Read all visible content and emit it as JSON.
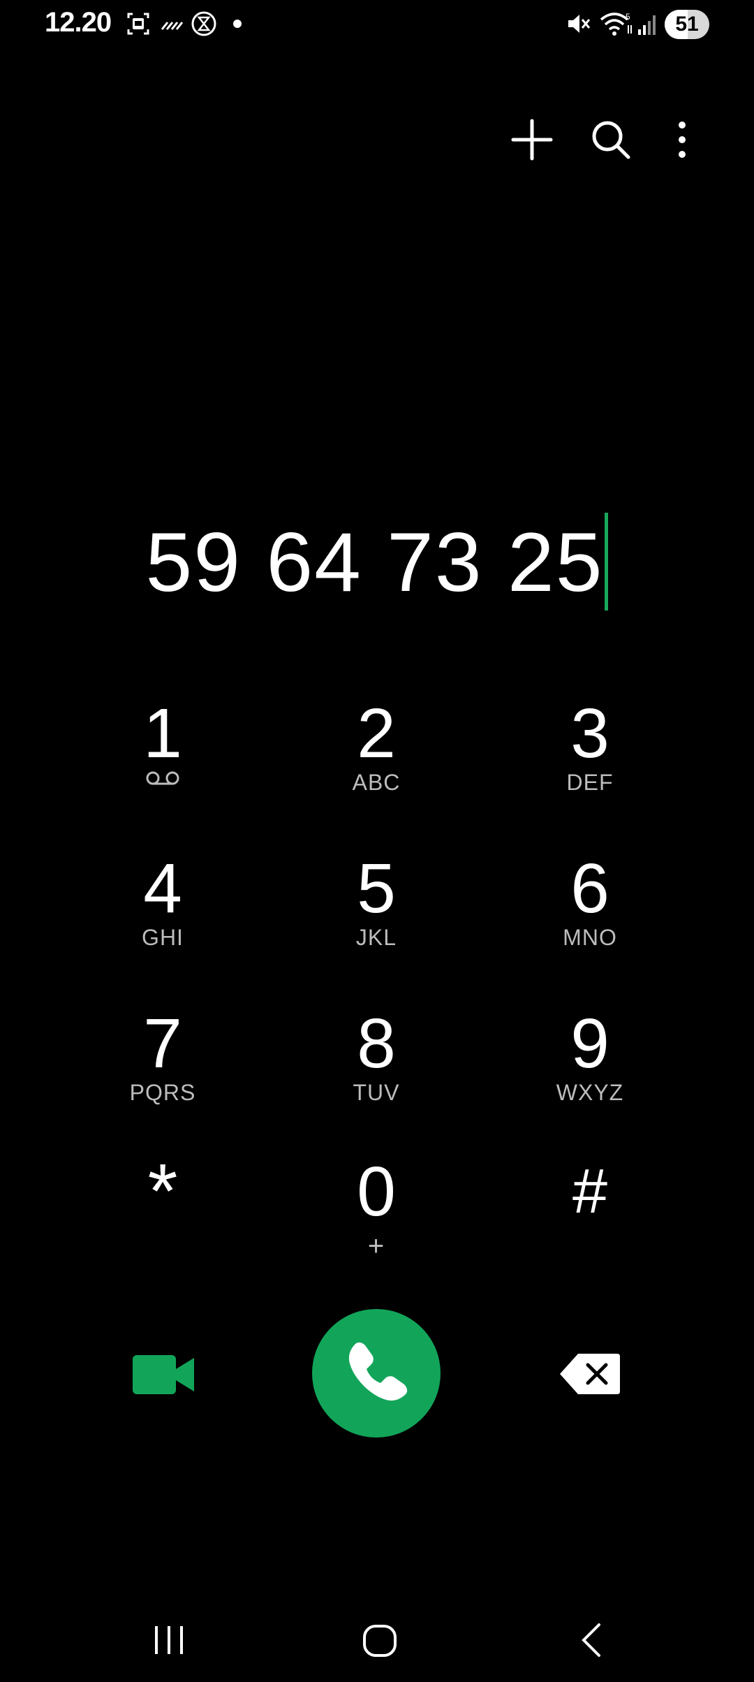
{
  "status_bar": {
    "time": "12.20",
    "battery": "51",
    "icons": [
      "screenshot-icon",
      "signal-stripes-icon",
      "hourglass-icon",
      "notification-dot-icon",
      "mute-icon",
      "wifi-icon",
      "cell-signal-icon"
    ]
  },
  "top_actions": {
    "icons": [
      "add-icon",
      "search-icon",
      "more-vert-icon"
    ]
  },
  "dialer": {
    "number": "59 64 73 25"
  },
  "keypad": {
    "keys": [
      {
        "digit": "1",
        "letters": "",
        "sub_icon": "voicemail-icon"
      },
      {
        "digit": "2",
        "letters": "ABC"
      },
      {
        "digit": "3",
        "letters": "DEF"
      },
      {
        "digit": "4",
        "letters": "GHI"
      },
      {
        "digit": "5",
        "letters": "JKL"
      },
      {
        "digit": "6",
        "letters": "MNO"
      },
      {
        "digit": "7",
        "letters": "PQRS"
      },
      {
        "digit": "8",
        "letters": "TUV"
      },
      {
        "digit": "9",
        "letters": "WXYZ"
      },
      {
        "digit": "*",
        "letters": ""
      },
      {
        "digit": "0",
        "letters": "+"
      },
      {
        "digit": "#",
        "letters": ""
      }
    ]
  },
  "actions": {
    "icons": [
      "video-call-icon",
      "phone-icon",
      "backspace-icon"
    ],
    "accent_color": "#12a55a"
  },
  "nav_bar": {
    "icons": [
      "recents-icon",
      "home-icon",
      "back-icon"
    ]
  }
}
